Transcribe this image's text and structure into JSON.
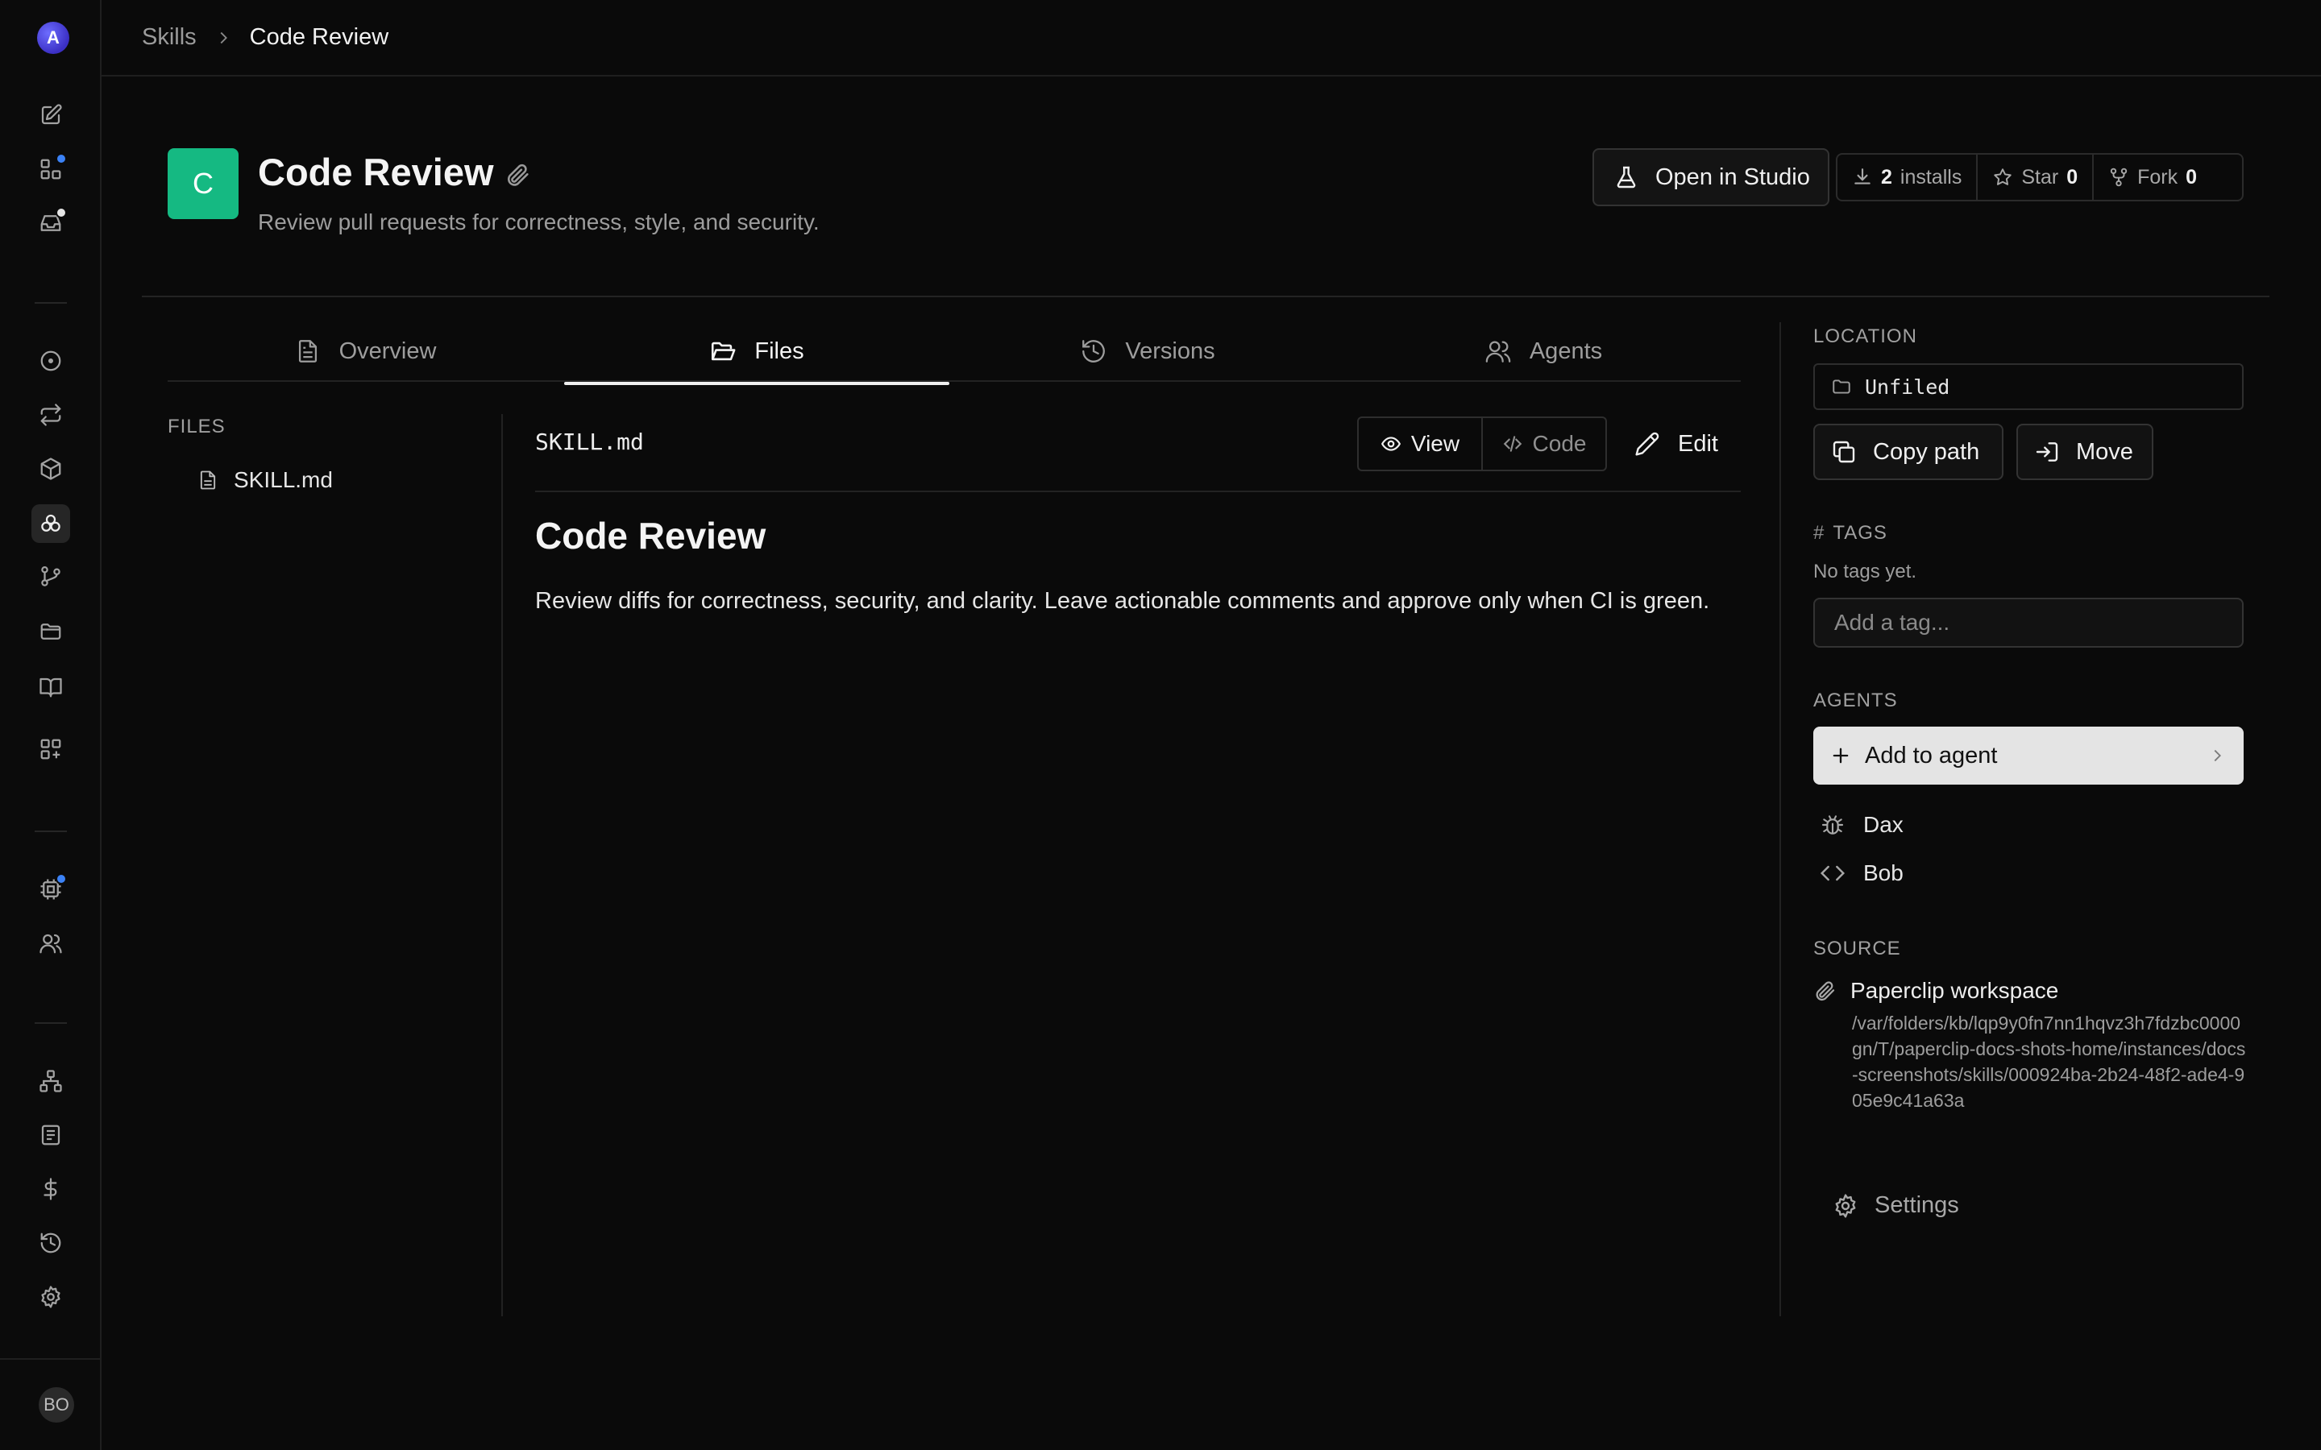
{
  "rail": {
    "workspace_initial": "A",
    "user_initials": "BO",
    "icons": [
      "edit-icon",
      "dashboard-icon",
      "inbox-icon",
      "circle-dot-icon",
      "repeat-icon",
      "package-icon",
      "skills-icon",
      "git-branch-icon",
      "folder-icon",
      "book-icon",
      "apps-icon",
      "cpu-icon",
      "users-icon",
      "org-chart-icon",
      "document-icon",
      "dollar-icon",
      "history-icon",
      "settings-icon"
    ],
    "badge_color": "#3b82f6"
  },
  "breadcrumb": {
    "root": "Skills",
    "current": "Code Review"
  },
  "header": {
    "logo_initial": "C",
    "logo_color": "#15b982",
    "title": "Code Review",
    "description": "Review pull requests for correctness, style, and security.",
    "open_studio_label": "Open in Studio",
    "installs_count": "2",
    "installs_label": "installs",
    "star_label": "Star",
    "star_count": "0",
    "fork_label": "Fork",
    "fork_count": "0"
  },
  "tabs": [
    {
      "label": "Overview",
      "icon": "file-text-icon",
      "active": false
    },
    {
      "label": "Files",
      "icon": "folder-open-icon",
      "active": true
    },
    {
      "label": "Versions",
      "icon": "history-icon",
      "active": false
    },
    {
      "label": "Agents",
      "icon": "users-icon",
      "active": false
    }
  ],
  "files": {
    "heading": "FILES",
    "items": [
      {
        "name": "SKILL.md",
        "icon": "file-icon"
      }
    ]
  },
  "viewer": {
    "file_name": "SKILL.md",
    "view_label": "View",
    "code_label": "Code",
    "edit_label": "Edit",
    "mode": "View",
    "doc_heading": "Code Review",
    "doc_body": "Review diffs for correctness, security, and clarity. Leave actionable comments and approve only when CI is green."
  },
  "sidebar": {
    "location_label": "LOCATION",
    "location_value": "Unfiled",
    "copy_path_label": "Copy path",
    "move_label": "Move",
    "tags_label": "TAGS",
    "no_tags": "No tags yet.",
    "tag_placeholder": "Add a tag...",
    "agents_label": "AGENTS",
    "add_agent_label": "Add to agent",
    "agents": [
      {
        "name": "Dax",
        "icon": "bug-icon"
      },
      {
        "name": "Bob",
        "icon": "code-icon"
      }
    ],
    "source_label": "SOURCE",
    "source_name": "Paperclip workspace",
    "source_path": "/var/folders/kb/lqp9y0fn7nn1hqvz3h7fdzbc0000gn/T/paperclip-docs-shots-home/instances/docs-screenshots/skills/000924ba-2b24-48f2-ade4-905e9c41a63a",
    "settings_label": "Settings"
  }
}
